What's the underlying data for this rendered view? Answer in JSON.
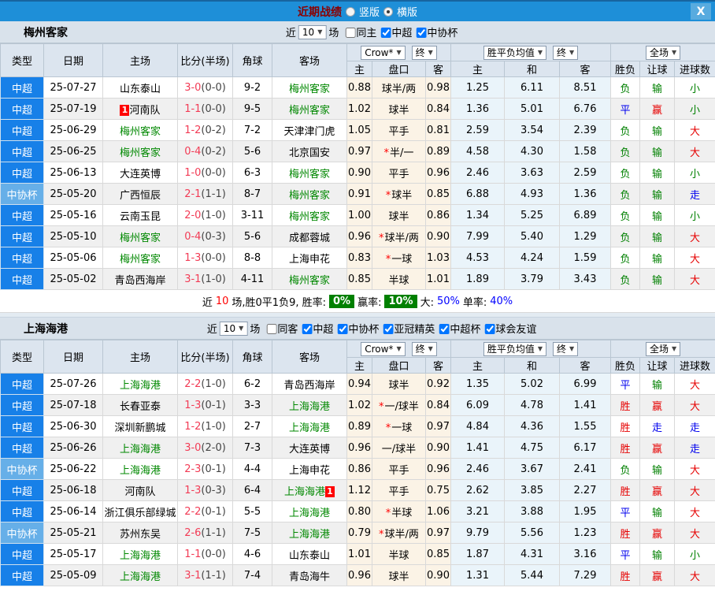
{
  "titlebar": {
    "title": "近期战绩",
    "layout_options": [
      {
        "label": "竖版",
        "selected": false
      },
      {
        "label": "横版",
        "selected": true
      }
    ],
    "close_label": "X"
  },
  "colors": {
    "titlebar_blue": "#1E8FD8",
    "league_csl_blue": "#1780E8",
    "league_cup_blue": "#66AFE8",
    "team_highlight_green": "#008800",
    "score_red": "#F23B55",
    "win_red": "#E60000",
    "loss_green": "#008000",
    "draw_blue": "#0000EE",
    "odds_cream_bg": "#FBF3E6",
    "avg_blue_bg": "#EAF4FA",
    "summary_badge_green": "#008000"
  },
  "sections": [
    {
      "team": "梅州客家",
      "filters": {
        "recent_label": "近",
        "count": "10",
        "unit_label": "场",
        "checkboxes": [
          {
            "label": "同主",
            "checked": false
          },
          {
            "label": "中超",
            "checked": true
          },
          {
            "label": "中协杯",
            "checked": true
          }
        ]
      },
      "header": {
        "cols": [
          "类型",
          "日期",
          "主场",
          "比分(半场)",
          "角球",
          "客场"
        ],
        "group1_dropdowns": [
          "Crow*",
          "终"
        ],
        "group1_cols": [
          "主",
          "盘口",
          "客"
        ],
        "group2_dropdowns": [
          "胜平负均值",
          "终"
        ],
        "group2_cols": [
          "主",
          "和",
          "客"
        ],
        "group3_dropdowns": [
          "全场"
        ],
        "group3_cols": [
          "胜负",
          "让球",
          "进球数"
        ]
      },
      "rows": [
        {
          "league": "中超",
          "cup": false,
          "date": "25-07-27",
          "home": {
            "name": "山东泰山",
            "green": false
          },
          "score": "3-0",
          "half": "(0-0)",
          "corner": "9-2",
          "away": {
            "name": "梅州客家",
            "green": true
          },
          "o1": "0.88",
          "hcp": "球半/两",
          "star": false,
          "o2": "0.98",
          "a1": "1.25",
          "a2": "6.11",
          "a3": "8.51",
          "r1": [
            "负",
            "g"
          ],
          "r2": [
            "输",
            "g"
          ],
          "r3": [
            "小",
            "g"
          ]
        },
        {
          "league": "中超",
          "cup": false,
          "date": "25-07-19",
          "home": {
            "name": "河南队",
            "green": false,
            "badge": "1",
            "badge_pos": "before"
          },
          "score": "1-1",
          "half": "(0-0)",
          "corner": "9-5",
          "away": {
            "name": "梅州客家",
            "green": true
          },
          "o1": "1.02",
          "hcp": "球半",
          "star": false,
          "o2": "0.84",
          "a1": "1.36",
          "a2": "5.01",
          "a3": "6.76",
          "r1": [
            "平",
            "b"
          ],
          "r2": [
            "赢",
            "r"
          ],
          "r3": [
            "小",
            "g"
          ]
        },
        {
          "league": "中超",
          "cup": false,
          "date": "25-06-29",
          "home": {
            "name": "梅州客家",
            "green": true
          },
          "score": "1-2",
          "half": "(0-2)",
          "corner": "7-2",
          "away": {
            "name": "天津津门虎",
            "green": false
          },
          "o1": "1.05",
          "hcp": "平手",
          "star": false,
          "o2": "0.81",
          "a1": "2.59",
          "a2": "3.54",
          "a3": "2.39",
          "r1": [
            "负",
            "g"
          ],
          "r2": [
            "输",
            "g"
          ],
          "r3": [
            "大",
            "r"
          ]
        },
        {
          "league": "中超",
          "cup": false,
          "date": "25-06-25",
          "home": {
            "name": "梅州客家",
            "green": true
          },
          "score": "0-4",
          "half": "(0-2)",
          "corner": "5-6",
          "away": {
            "name": "北京国安",
            "green": false
          },
          "o1": "0.97",
          "hcp": "半/一",
          "star": true,
          "o2": "0.89",
          "a1": "4.58",
          "a2": "4.30",
          "a3": "1.58",
          "r1": [
            "负",
            "g"
          ],
          "r2": [
            "输",
            "g"
          ],
          "r3": [
            "大",
            "r"
          ]
        },
        {
          "league": "中超",
          "cup": false,
          "date": "25-06-13",
          "home": {
            "name": "大连英博",
            "green": false
          },
          "score": "1-0",
          "half": "(0-0)",
          "corner": "6-3",
          "away": {
            "name": "梅州客家",
            "green": true
          },
          "o1": "0.90",
          "hcp": "平手",
          "star": false,
          "o2": "0.96",
          "a1": "2.46",
          "a2": "3.63",
          "a3": "2.59",
          "r1": [
            "负",
            "g"
          ],
          "r2": [
            "输",
            "g"
          ],
          "r3": [
            "小",
            "g"
          ]
        },
        {
          "league": "中协杯",
          "cup": true,
          "date": "25-05-20",
          "home": {
            "name": "广西恒辰",
            "green": false
          },
          "score": "2-1",
          "half": "(1-1)",
          "corner": "8-7",
          "away": {
            "name": "梅州客家",
            "green": true
          },
          "o1": "0.91",
          "hcp": "球半",
          "star": true,
          "o2": "0.85",
          "a1": "6.88",
          "a2": "4.93",
          "a3": "1.36",
          "r1": [
            "负",
            "g"
          ],
          "r2": [
            "输",
            "g"
          ],
          "r3": [
            "走",
            "b"
          ]
        },
        {
          "league": "中超",
          "cup": false,
          "date": "25-05-16",
          "home": {
            "name": "云南玉昆",
            "green": false
          },
          "score": "2-0",
          "half": "(1-0)",
          "corner": "3-11",
          "away": {
            "name": "梅州客家",
            "green": true
          },
          "o1": "1.00",
          "hcp": "球半",
          "star": false,
          "o2": "0.86",
          "a1": "1.34",
          "a2": "5.25",
          "a3": "6.89",
          "r1": [
            "负",
            "g"
          ],
          "r2": [
            "输",
            "g"
          ],
          "r3": [
            "小",
            "g"
          ]
        },
        {
          "league": "中超",
          "cup": false,
          "date": "25-05-10",
          "home": {
            "name": "梅州客家",
            "green": true
          },
          "score": "0-4",
          "half": "(0-3)",
          "corner": "5-6",
          "away": {
            "name": "成都蓉城",
            "green": false
          },
          "o1": "0.96",
          "hcp": "球半/两",
          "star": true,
          "o2": "0.90",
          "a1": "7.99",
          "a2": "5.40",
          "a3": "1.29",
          "r1": [
            "负",
            "g"
          ],
          "r2": [
            "输",
            "g"
          ],
          "r3": [
            "大",
            "r"
          ]
        },
        {
          "league": "中超",
          "cup": false,
          "date": "25-05-06",
          "home": {
            "name": "梅州客家",
            "green": true
          },
          "score": "1-3",
          "half": "(0-0)",
          "corner": "8-8",
          "away": {
            "name": "上海申花",
            "green": false
          },
          "o1": "0.83",
          "hcp": "一球",
          "star": true,
          "o2": "1.03",
          "a1": "4.53",
          "a2": "4.24",
          "a3": "1.59",
          "r1": [
            "负",
            "g"
          ],
          "r2": [
            "输",
            "g"
          ],
          "r3": [
            "大",
            "r"
          ]
        },
        {
          "league": "中超",
          "cup": false,
          "date": "25-05-02",
          "home": {
            "name": "青岛西海岸",
            "green": false
          },
          "score": "3-1",
          "half": "(1-0)",
          "corner": "4-11",
          "away": {
            "name": "梅州客家",
            "green": true
          },
          "o1": "0.85",
          "hcp": "半球",
          "star": false,
          "o2": "1.01",
          "a1": "1.89",
          "a2": "3.79",
          "a3": "3.43",
          "r1": [
            "负",
            "g"
          ],
          "r2": [
            "输",
            "g"
          ],
          "r3": [
            "大",
            "r"
          ]
        }
      ],
      "summary": {
        "prefix_label": "近",
        "count": "10",
        "record_text": "场,胜0平1负9, 胜率:",
        "win_rate": "0%",
        "odds_win_label": "赢率:",
        "odds_win_rate": "10%",
        "big_label": "大:",
        "big_rate": "50%",
        "single_label": "单率:",
        "single_rate": "40%"
      }
    },
    {
      "team": "上海海港",
      "filters": {
        "recent_label": "近",
        "count": "10",
        "unit_label": "场",
        "checkboxes": [
          {
            "label": "同客",
            "checked": false
          },
          {
            "label": "中超",
            "checked": true
          },
          {
            "label": "中协杯",
            "checked": true
          },
          {
            "label": "亚冠精英",
            "checked": true
          },
          {
            "label": "中超杯",
            "checked": true
          },
          {
            "label": "球会友谊",
            "checked": true
          }
        ]
      },
      "header": {
        "cols": [
          "类型",
          "日期",
          "主场",
          "比分(半场)",
          "角球",
          "客场"
        ],
        "group1_dropdowns": [
          "Crow*",
          "终"
        ],
        "group1_cols": [
          "主",
          "盘口",
          "客"
        ],
        "group2_dropdowns": [
          "胜平负均值",
          "终"
        ],
        "group2_cols": [
          "主",
          "和",
          "客"
        ],
        "group3_dropdowns": [
          "全场"
        ],
        "group3_cols": [
          "胜负",
          "让球",
          "进球数"
        ]
      },
      "rows": [
        {
          "league": "中超",
          "cup": false,
          "date": "25-07-26",
          "home": {
            "name": "上海海港",
            "green": true
          },
          "score": "2-2",
          "half": "(1-0)",
          "corner": "6-2",
          "away": {
            "name": "青岛西海岸",
            "green": false
          },
          "o1": "0.94",
          "hcp": "球半",
          "star": false,
          "o2": "0.92",
          "a1": "1.35",
          "a2": "5.02",
          "a3": "6.99",
          "r1": [
            "平",
            "b"
          ],
          "r2": [
            "输",
            "g"
          ],
          "r3": [
            "大",
            "r"
          ]
        },
        {
          "league": "中超",
          "cup": false,
          "date": "25-07-18",
          "home": {
            "name": "长春亚泰",
            "green": false
          },
          "score": "1-3",
          "half": "(0-1)",
          "corner": "3-3",
          "away": {
            "name": "上海海港",
            "green": true
          },
          "o1": "1.02",
          "hcp": "一/球半",
          "star": true,
          "o2": "0.84",
          "a1": "6.09",
          "a2": "4.78",
          "a3": "1.41",
          "r1": [
            "胜",
            "r"
          ],
          "r2": [
            "赢",
            "r"
          ],
          "r3": [
            "大",
            "r"
          ]
        },
        {
          "league": "中超",
          "cup": false,
          "date": "25-06-30",
          "home": {
            "name": "深圳新鹏城",
            "green": false
          },
          "score": "1-2",
          "half": "(1-0)",
          "corner": "2-7",
          "away": {
            "name": "上海海港",
            "green": true
          },
          "o1": "0.89",
          "hcp": "一球",
          "star": true,
          "o2": "0.97",
          "a1": "4.84",
          "a2": "4.36",
          "a3": "1.55",
          "r1": [
            "胜",
            "r"
          ],
          "r2": [
            "走",
            "b"
          ],
          "r3": [
            "走",
            "b"
          ]
        },
        {
          "league": "中超",
          "cup": false,
          "date": "25-06-26",
          "home": {
            "name": "上海海港",
            "green": true
          },
          "score": "3-0",
          "half": "(2-0)",
          "corner": "7-3",
          "away": {
            "name": "大连英博",
            "green": false
          },
          "o1": "0.96",
          "hcp": "一/球半",
          "star": false,
          "o2": "0.90",
          "a1": "1.41",
          "a2": "4.75",
          "a3": "6.17",
          "r1": [
            "胜",
            "r"
          ],
          "r2": [
            "赢",
            "r"
          ],
          "r3": [
            "走",
            "b"
          ]
        },
        {
          "league": "中协杯",
          "cup": true,
          "date": "25-06-22",
          "home": {
            "name": "上海海港",
            "green": true
          },
          "score": "2-3",
          "half": "(0-1)",
          "corner": "4-4",
          "away": {
            "name": "上海申花",
            "green": false
          },
          "o1": "0.86",
          "hcp": "平手",
          "star": false,
          "o2": "0.96",
          "a1": "2.46",
          "a2": "3.67",
          "a3": "2.41",
          "r1": [
            "负",
            "g"
          ],
          "r2": [
            "输",
            "g"
          ],
          "r3": [
            "大",
            "r"
          ]
        },
        {
          "league": "中超",
          "cup": false,
          "date": "25-06-18",
          "home": {
            "name": "河南队",
            "green": false
          },
          "score": "1-3",
          "half": "(0-3)",
          "corner": "6-4",
          "away": {
            "name": "上海海港",
            "green": true,
            "badge": "1",
            "badge_pos": "after"
          },
          "o1": "1.12",
          "hcp": "平手",
          "star": false,
          "o2": "0.75",
          "a1": "2.62",
          "a2": "3.85",
          "a3": "2.27",
          "r1": [
            "胜",
            "r"
          ],
          "r2": [
            "赢",
            "r"
          ],
          "r3": [
            "大",
            "r"
          ]
        },
        {
          "league": "中超",
          "cup": false,
          "date": "25-06-14",
          "home": {
            "name": "浙江俱乐部绿城",
            "green": false
          },
          "score": "2-2",
          "half": "(0-1)",
          "corner": "5-5",
          "away": {
            "name": "上海海港",
            "green": true
          },
          "o1": "0.80",
          "hcp": "半球",
          "star": true,
          "o2": "1.06",
          "a1": "3.21",
          "a2": "3.88",
          "a3": "1.95",
          "r1": [
            "平",
            "b"
          ],
          "r2": [
            "输",
            "g"
          ],
          "r3": [
            "大",
            "r"
          ]
        },
        {
          "league": "中协杯",
          "cup": true,
          "date": "25-05-21",
          "home": {
            "name": "苏州东吴",
            "green": false
          },
          "score": "2-6",
          "half": "(1-1)",
          "corner": "7-5",
          "away": {
            "name": "上海海港",
            "green": true
          },
          "o1": "0.79",
          "hcp": "球半/两",
          "star": true,
          "o2": "0.97",
          "a1": "9.79",
          "a2": "5.56",
          "a3": "1.23",
          "r1": [
            "胜",
            "r"
          ],
          "r2": [
            "赢",
            "r"
          ],
          "r3": [
            "大",
            "r"
          ]
        },
        {
          "league": "中超",
          "cup": false,
          "date": "25-05-17",
          "home": {
            "name": "上海海港",
            "green": true
          },
          "score": "1-1",
          "half": "(0-0)",
          "corner": "4-6",
          "away": {
            "name": "山东泰山",
            "green": false
          },
          "o1": "1.01",
          "hcp": "半球",
          "star": false,
          "o2": "0.85",
          "a1": "1.87",
          "a2": "4.31",
          "a3": "3.16",
          "r1": [
            "平",
            "b"
          ],
          "r2": [
            "输",
            "g"
          ],
          "r3": [
            "小",
            "g"
          ]
        },
        {
          "league": "中超",
          "cup": false,
          "date": "25-05-09",
          "home": {
            "name": "上海海港",
            "green": true
          },
          "score": "3-1",
          "half": "(1-1)",
          "corner": "7-4",
          "away": {
            "name": "青岛海牛",
            "green": false
          },
          "o1": "0.96",
          "hcp": "球半",
          "star": false,
          "o2": "0.90",
          "a1": "1.31",
          "a2": "5.44",
          "a3": "7.29",
          "r1": [
            "胜",
            "r"
          ],
          "r2": [
            "赢",
            "r"
          ],
          "r3": [
            "大",
            "r"
          ]
        }
      ]
    }
  ]
}
